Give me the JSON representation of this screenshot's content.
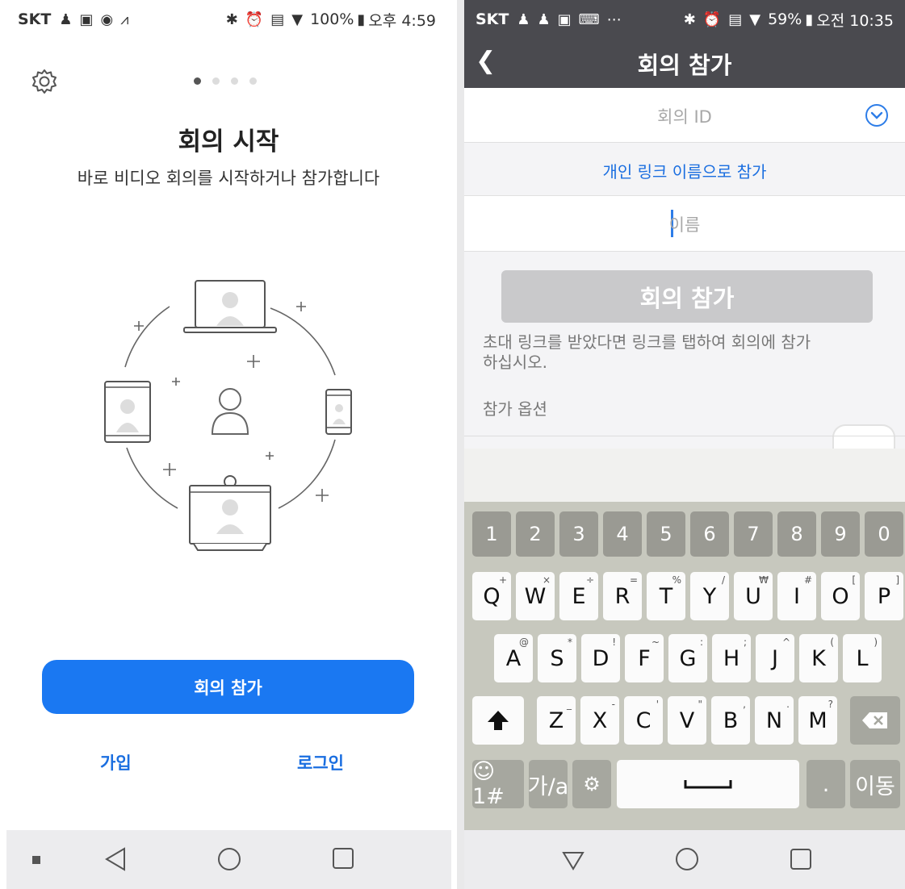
{
  "left_screen": {
    "status": {
      "carrier": "SKT",
      "battery": "100%",
      "clock": "오후 4:59",
      "icons": [
        "person-icon",
        "sim-icon",
        "app-icon",
        "chart-icon",
        "bluetooth-icon",
        "alarm-icon",
        "hd-voice-icon",
        "wifi-icon",
        "signal-icon",
        "battery-icon"
      ]
    },
    "carousel": {
      "page_count": 4,
      "active_index": 0
    },
    "title": "회의 시작",
    "subtitle": "바로 비디오 회의를 시작하거나 참가합니다",
    "join_button": "회의 참가",
    "signup_link": "가입",
    "login_link": "로그인",
    "nav_icons": [
      "square-small-icon",
      "back-triangle-icon",
      "home-circle-icon",
      "recents-square-icon"
    ]
  },
  "right_screen": {
    "status": {
      "carrier": "SKT",
      "battery": "59%",
      "clock": "오전 10:35"
    },
    "header_title": "회의 참가",
    "meeting_id_placeholder": "회의 ID",
    "personal_link_text": "개인 링크 이름으로 참가",
    "name_placeholder": "이름",
    "join_button": "회의 참가",
    "hint_text": "초대 링크를 받았다면 링크를 탭하여 회의에 참가하십시오.",
    "options_label": "참가 옵션",
    "keyboard": {
      "numbers": [
        "1",
        "2",
        "3",
        "4",
        "5",
        "6",
        "7",
        "8",
        "9",
        "0"
      ],
      "row1": [
        {
          "k": "Q",
          "s": "+"
        },
        {
          "k": "W",
          "s": "×"
        },
        {
          "k": "E",
          "s": "÷"
        },
        {
          "k": "R",
          "s": "="
        },
        {
          "k": "T",
          "s": "%"
        },
        {
          "k": "Y",
          "s": "/"
        },
        {
          "k": "U",
          "s": "₩"
        },
        {
          "k": "I",
          "s": "#"
        },
        {
          "k": "O",
          "s": "["
        },
        {
          "k": "P",
          "s": "]"
        }
      ],
      "row2": [
        {
          "k": "A",
          "s": "@"
        },
        {
          "k": "S",
          "s": "*"
        },
        {
          "k": "D",
          "s": "!"
        },
        {
          "k": "F",
          "s": "~"
        },
        {
          "k": "G",
          "s": ":"
        },
        {
          "k": "H",
          "s": ";"
        },
        {
          "k": "J",
          "s": "^"
        },
        {
          "k": "K",
          "s": "("
        },
        {
          "k": "L",
          "s": ")"
        }
      ],
      "row3": [
        {
          "k": "Z",
          "s": "_"
        },
        {
          "k": "X",
          "s": "-"
        },
        {
          "k": "C",
          "s": "'"
        },
        {
          "k": "V",
          "s": "\""
        },
        {
          "k": "B",
          "s": ","
        },
        {
          "k": "N",
          "s": "."
        },
        {
          "k": "M",
          "s": "?"
        }
      ],
      "symbols_key": "☺1#",
      "lang_key": "가/a",
      "period_key": ".",
      "go_key": "이동",
      "shift_icon": "shift-up-icon",
      "backspace_icon": "backspace-icon",
      "settings_icon": "settings-gear-icon",
      "space_icon": "space-bar-icon"
    },
    "nav_icons": [
      "back-triangle-down-icon",
      "home-circle-icon",
      "recents-square-icon"
    ]
  }
}
